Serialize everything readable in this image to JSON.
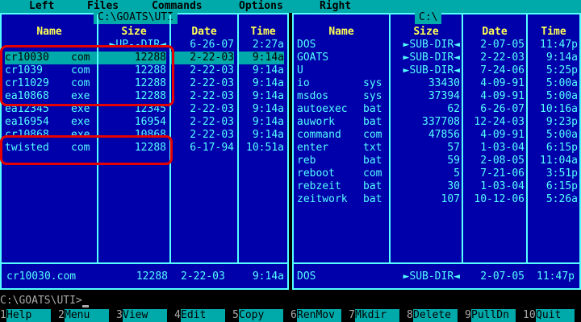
{
  "menu": [
    "Left",
    "Files",
    "Commands",
    "Options",
    "Right"
  ],
  "left_panel": {
    "title": "C:\\GOATS\\UTI",
    "headers": [
      "Name",
      "Size",
      "Date",
      "Time"
    ],
    "rows": [
      {
        "name": "..",
        "ext": "",
        "size": "►UP--DIR◄",
        "date": "6-26-07",
        "time": "2:27a",
        "selected": false
      },
      {
        "name": "cr10030",
        "ext": "com",
        "size": "12288",
        "date": "2-22-03",
        "time": "9:14a",
        "selected": true
      },
      {
        "name": "cr1039",
        "ext": "com",
        "size": "12288",
        "date": "2-22-03",
        "time": "9:14a",
        "selected": false
      },
      {
        "name": "cr11029",
        "ext": "com",
        "size": "12288",
        "date": "2-22-03",
        "time": "9:14a",
        "selected": false
      },
      {
        "name": "ea10868",
        "ext": "exe",
        "size": "12288",
        "date": "2-22-03",
        "time": "9:14a",
        "selected": false
      },
      {
        "name": "ea12345",
        "ext": "exe",
        "size": "12345",
        "date": "2-22-03",
        "time": "9:14a",
        "selected": false
      },
      {
        "name": "ea16954",
        "ext": "exe",
        "size": "16954",
        "date": "2-22-03",
        "time": "9:14a",
        "selected": false
      },
      {
        "name": "cr10868",
        "ext": "exe",
        "size": "10868",
        "date": "2-22-03",
        "time": "9:14a",
        "selected": false
      },
      {
        "name": "twisted",
        "ext": "com",
        "size": "12288",
        "date": "6-17-94",
        "time": "10:51a",
        "selected": false
      }
    ],
    "status": {
      "name": "cr10030.com",
      "size": "12288",
      "date": "2-22-03",
      "time": "9:14a"
    }
  },
  "right_panel": {
    "title": "C:\\",
    "headers": [
      "Name",
      "Size",
      "Date",
      "Time"
    ],
    "rows": [
      {
        "name": "DOS",
        "ext": "",
        "size": "►SUB-DIR◄",
        "date": "2-07-05",
        "time": "11:47p"
      },
      {
        "name": "GOATS",
        "ext": "",
        "size": "►SUB-DIR◄",
        "date": "2-22-03",
        "time": "9:14a"
      },
      {
        "name": "U",
        "ext": "",
        "size": "►SUB-DIR◄",
        "date": "7-24-06",
        "time": "5:25p"
      },
      {
        "name": "io",
        "ext": "sys",
        "size": "33430",
        "date": "4-09-91",
        "time": "5:00a"
      },
      {
        "name": "msdos",
        "ext": "sys",
        "size": "37394",
        "date": "4-09-91",
        "time": "5:00a"
      },
      {
        "name": "autoexec",
        "ext": "bat",
        "size": "62",
        "date": "6-26-07",
        "time": "10:16a"
      },
      {
        "name": "auwork",
        "ext": "bat",
        "size": "337708",
        "date": "12-24-03",
        "time": "9:23p"
      },
      {
        "name": "command",
        "ext": "com",
        "size": "47856",
        "date": "4-09-91",
        "time": "5:00a"
      },
      {
        "name": "enter",
        "ext": "txt",
        "size": "57",
        "date": "1-03-04",
        "time": "6:15p"
      },
      {
        "name": "reb",
        "ext": "bat",
        "size": "59",
        "date": "2-08-05",
        "time": "11:04a"
      },
      {
        "name": "reboot",
        "ext": "com",
        "size": "5",
        "date": "7-21-06",
        "time": "3:51p"
      },
      {
        "name": "rebzeit",
        "ext": "bat",
        "size": "30",
        "date": "1-03-04",
        "time": "6:15p"
      },
      {
        "name": "zeitwork",
        "ext": "bat",
        "size": "107",
        "date": "10-12-06",
        "time": "5:26a"
      }
    ],
    "status": {
      "name": "DOS",
      "size": "►SUB-DIR◄",
      "date": "2-07-05",
      "time": "11:47p"
    }
  },
  "command_line": {
    "prompt": "C:\\GOATS\\UTI>"
  },
  "function_keys": [
    {
      "num": "1",
      "label": "Help"
    },
    {
      "num": "2",
      "label": "Menu"
    },
    {
      "num": "3",
      "label": "View"
    },
    {
      "num": "4",
      "label": "Edit"
    },
    {
      "num": "5",
      "label": "Copy"
    },
    {
      "num": "6",
      "label": "RenMov"
    },
    {
      "num": "7",
      "label": "Mkdir"
    },
    {
      "num": "8",
      "label": "Delete"
    },
    {
      "num": "9",
      "label": "PullDn"
    },
    {
      "num": "10",
      "label": "Quit"
    }
  ],
  "colors": {
    "panel_bg": "#0000aa",
    "text": "#55ffff",
    "header": "#ffff55",
    "bar": "#00aaaa",
    "annotation": "#e60000"
  }
}
